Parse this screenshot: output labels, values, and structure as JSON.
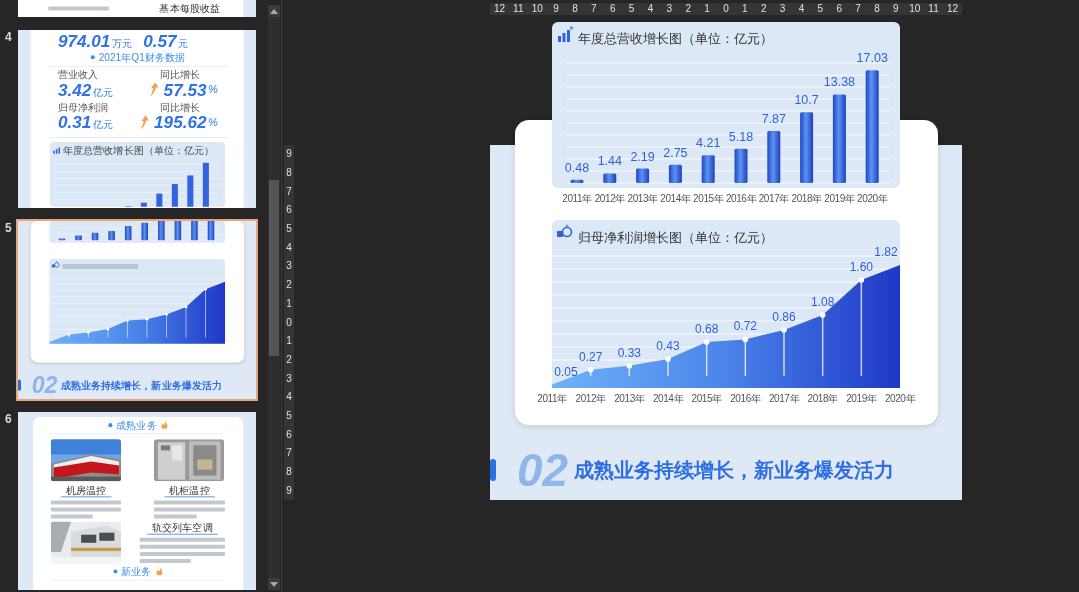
{
  "slide_panel": {
    "peek": {
      "text": "基本每股收益"
    },
    "slides": [
      {
        "number": "4",
        "selected": false,
        "kind": "finance",
        "headline_metrics": [
          {
            "value": "974.01",
            "unit": "万元"
          },
          {
            "value": "0.57",
            "unit": "元"
          }
        ],
        "section_title": "2021年Q1财务数据",
        "metrics": [
          {
            "label": "营业收入",
            "value": "3.42",
            "unit": "亿元",
            "kind": "amount"
          },
          {
            "label": "同比增长",
            "value": "57.53",
            "unit": "%",
            "kind": "growth"
          },
          {
            "label": "归母净利润",
            "value": "0.31",
            "unit": "亿元",
            "kind": "amount"
          },
          {
            "label": "同比增长",
            "value": "195.62",
            "unit": "%",
            "kind": "growth"
          }
        ],
        "chart_title": "年度总营收增长图（单位：亿元）"
      },
      {
        "number": "5",
        "selected": true,
        "kind": "charts",
        "section_number": "02",
        "heading": "成熟业务持续增长，新业务爆发活力"
      },
      {
        "number": "6",
        "selected": false,
        "kind": "business",
        "section_title": "成熟业务",
        "cases": [
          {
            "caption": "机房温控"
          },
          {
            "caption": "机柜温控"
          },
          {
            "caption": "轨交列车空调"
          }
        ],
        "next_section_title": "新业务"
      }
    ]
  },
  "rulers": {
    "horizontal": [
      "12",
      "11",
      "10",
      "9",
      "8",
      "7",
      "6",
      "5",
      "4",
      "3",
      "2",
      "1",
      "0",
      "1",
      "2",
      "3",
      "4",
      "5",
      "6",
      "7",
      "8",
      "9",
      "10",
      "11",
      "12"
    ],
    "vertical": [
      "9",
      "8",
      "7",
      "6",
      "5",
      "4",
      "3",
      "2",
      "1",
      "0",
      "1",
      "2",
      "3",
      "4",
      "5",
      "6",
      "7",
      "8",
      "9"
    ]
  },
  "slide": {
    "revenue_chart": {
      "title": "年度总营收增长图（单位：亿元）",
      "chart_data": {
        "type": "bar",
        "categories": [
          "2011年",
          "2012年",
          "2013年",
          "2014年",
          "2015年",
          "2016年",
          "2017年",
          "2018年",
          "2019年",
          "2020年"
        ],
        "values": [
          0.48,
          1.44,
          2.19,
          2.75,
          4.21,
          5.18,
          7.87,
          10.7,
          13.38,
          17.03
        ],
        "value_labels": [
          "0.48",
          "1.44",
          "2.19",
          "2.75",
          "4.21",
          "5.18",
          "7.87",
          "10.7",
          "13.38",
          "17.03"
        ]
      }
    },
    "profit_chart": {
      "title": "归母净利润增长图（单位：亿元）",
      "chart_data": {
        "type": "area",
        "categories": [
          "2011年",
          "2012年",
          "2013年",
          "2014年",
          "2015年",
          "2016年",
          "2017年",
          "2018年",
          "2019年",
          "2020年"
        ],
        "values": [
          0.05,
          0.27,
          0.33,
          0.43,
          0.68,
          0.72,
          0.86,
          1.08,
          1.6,
          1.82
        ],
        "value_labels": [
          "0.05",
          "0.27",
          "0.33",
          "0.43",
          "0.68",
          "0.72",
          "0.86",
          "1.08",
          "1.60",
          "1.82"
        ]
      }
    },
    "section_number": "02",
    "heading": "成熟业务持续增长，新业务爆发活力"
  }
}
